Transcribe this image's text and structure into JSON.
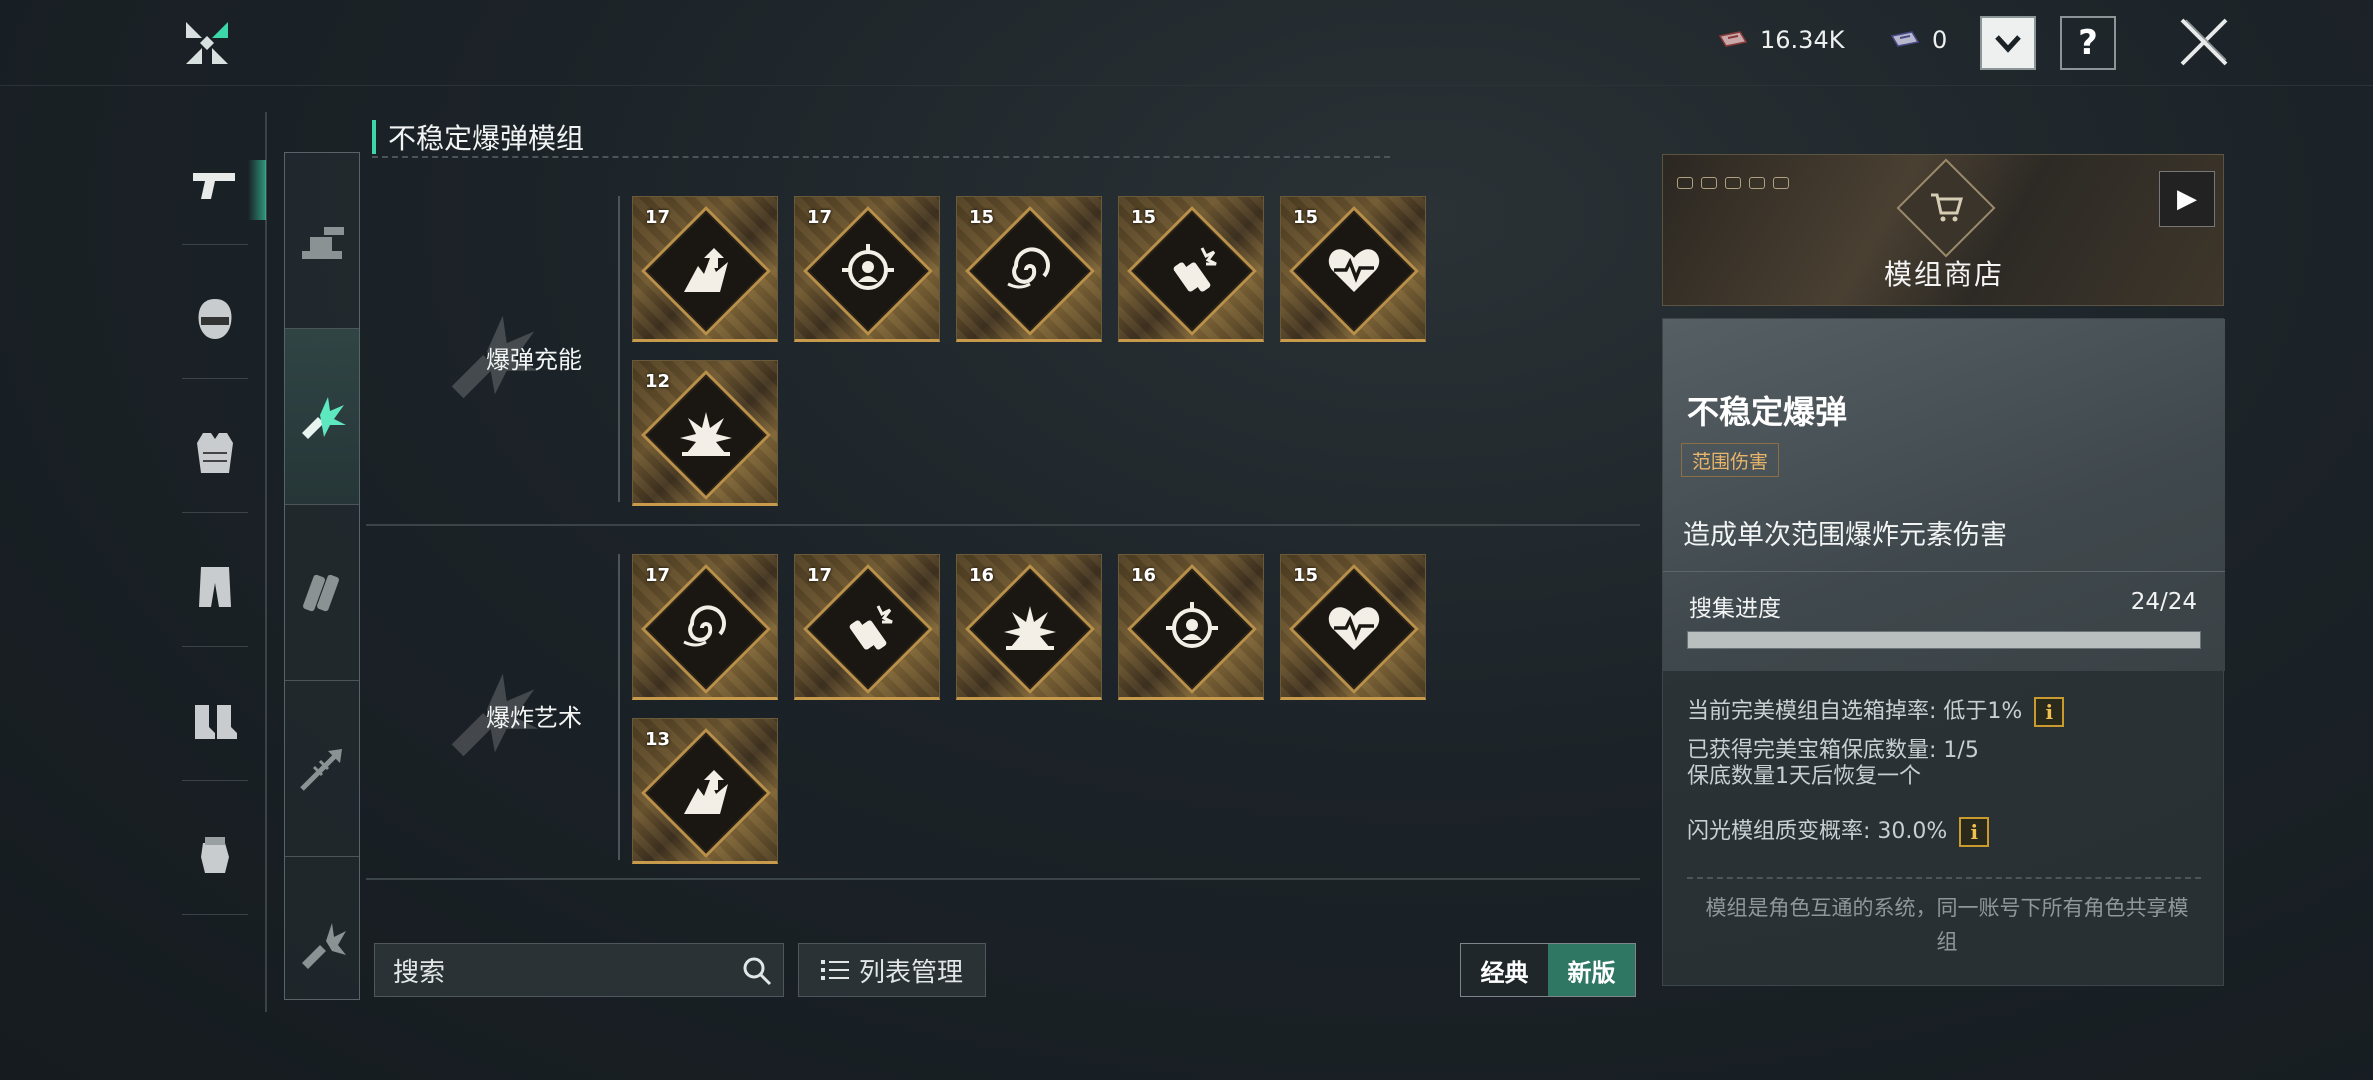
{
  "header": {
    "currency_1": "16.34K",
    "currency_2": "0",
    "dropdown_glyph": "⌄",
    "help_label": "?"
  },
  "icons": {
    "logo": "game-logo-icon",
    "currency_1": "ticket-red-icon",
    "currency_2": "ticket-blue-icon",
    "close": "close-x-icon"
  },
  "sidebar": {
    "items": [
      {
        "name": "pistol-icon",
        "active": true
      },
      {
        "name": "helmet-icon"
      },
      {
        "name": "armor-vest-icon"
      },
      {
        "name": "pants-icon"
      },
      {
        "name": "boots-icon"
      },
      {
        "name": "gloves-icon"
      }
    ]
  },
  "subnav": {
    "items": [
      {
        "name": "turret-icon"
      },
      {
        "name": "unstable-bomb-icon",
        "active": true
      },
      {
        "name": "dynamite-icon"
      },
      {
        "name": "arrow-strike-icon"
      },
      {
        "name": "firework-icon"
      }
    ]
  },
  "main": {
    "section_title": "不稳定爆弹模组",
    "groups": [
      {
        "label": "爆弹充能",
        "cards": [
          {
            "level": "17",
            "icon": "explosion-arrow-icon"
          },
          {
            "level": "17",
            "icon": "target-crosshair-icon"
          },
          {
            "level": "15",
            "icon": "vortex-icon"
          },
          {
            "level": "15",
            "icon": "dynamite-spark-icon"
          },
          {
            "level": "15",
            "icon": "heart-pulse-icon"
          },
          {
            "level": "12",
            "icon": "blast-icon"
          }
        ]
      },
      {
        "label": "爆炸艺术",
        "cards": [
          {
            "level": "17",
            "icon": "vortex-icon"
          },
          {
            "level": "17",
            "icon": "dynamite-spark-icon"
          },
          {
            "level": "16",
            "icon": "blast-icon"
          },
          {
            "level": "16",
            "icon": "target-crosshair-icon"
          },
          {
            "level": "15",
            "icon": "heart-pulse-icon"
          },
          {
            "level": "13",
            "icon": "explosion-arrow-icon"
          }
        ]
      }
    ]
  },
  "bottombar": {
    "search_placeholder": "搜索",
    "list_manage_label": "列表管理",
    "toggle_classic": "经典",
    "toggle_new": "新版",
    "active_toggle": "新版"
  },
  "shop": {
    "label": "模组商店",
    "arrow": "▶"
  },
  "details": {
    "name": "不稳定爆弹",
    "tag": "范围伤害",
    "description": "造成单次范围爆炸元素伤害",
    "progress_label": "搜集进度",
    "progress_value": "24/24",
    "progress_fraction": 1.0,
    "stat_1": "当前完美模组自选箱掉率: 低于1%",
    "stat_2": "已获得完美宝箱保底数量: 1/5",
    "stat_3": "保底数量1天后恢复一个",
    "stat_4": "闪光模组质变概率: 30.0%",
    "info_glyph": "i",
    "footer": "模组是角色互通的系统，同一账号下所有角色共享模组"
  },
  "colors": {
    "accent_green": "#3cd6a8",
    "card_gold": "#c79a4c",
    "tag_orange": "#e9b56a",
    "info_yellow": "#c99a2e"
  }
}
